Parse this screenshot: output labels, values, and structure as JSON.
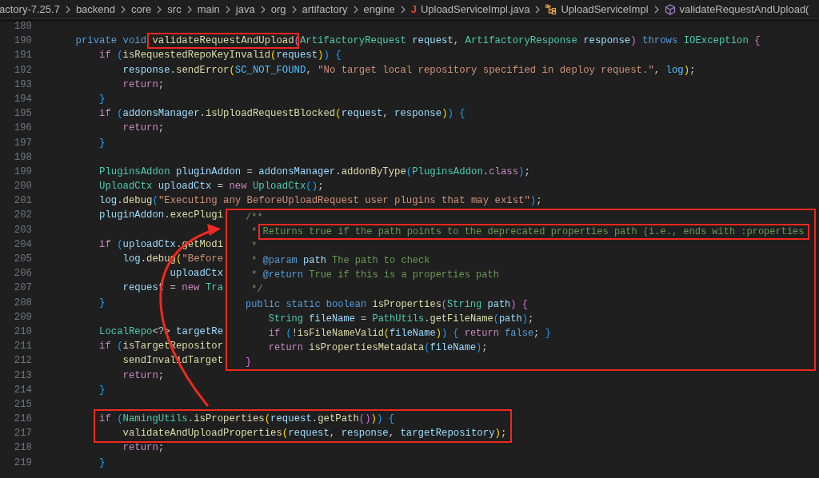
{
  "breadcrumb": [
    {
      "kind": "folder",
      "label": "actory-7.25.7"
    },
    {
      "kind": "folder",
      "label": "backend"
    },
    {
      "kind": "folder",
      "label": "core"
    },
    {
      "kind": "folder",
      "label": "src"
    },
    {
      "kind": "folder",
      "label": "main"
    },
    {
      "kind": "folder",
      "label": "java"
    },
    {
      "kind": "folder",
      "label": "org"
    },
    {
      "kind": "folder",
      "label": "artifactory"
    },
    {
      "kind": "folder",
      "label": "engine"
    },
    {
      "kind": "java-file",
      "icon": "J",
      "label": "UploadServiceImpl.java"
    },
    {
      "kind": "class",
      "label": "UploadServiceImpl"
    },
    {
      "kind": "method",
      "label": "validateRequestAndUpload("
    }
  ],
  "editor": {
    "lines": [
      {
        "number": "189"
      },
      {
        "number": "190",
        "tokens": [
          {
            "kind": "kw",
            "text": "    private void "
          },
          {
            "kind": "fn",
            "text": "validateRequestAndUpload",
            "boxed": true
          },
          {
            "kind": "b2",
            "text": "("
          },
          {
            "kind": "type",
            "text": "ArtifactoryRequest "
          },
          {
            "kind": "var",
            "text": "request"
          },
          {
            "kind": "p",
            "text": ", "
          },
          {
            "kind": "type",
            "text": "ArtifactoryResponse "
          },
          {
            "kind": "var",
            "text": "response"
          },
          {
            "kind": "b2",
            "text": ")"
          },
          {
            "kind": "kw",
            "text": " throws "
          },
          {
            "kind": "type",
            "text": "IOException "
          },
          {
            "kind": "b2",
            "text": "{"
          }
        ]
      },
      {
        "number": "191",
        "tokens": [
          {
            "kind": "ctl",
            "text": "        if "
          },
          {
            "kind": "b3",
            "text": "("
          },
          {
            "kind": "fn",
            "text": "isRequestedRepoKeyInvalid"
          },
          {
            "kind": "b1",
            "text": "("
          },
          {
            "kind": "var",
            "text": "request"
          },
          {
            "kind": "b1",
            "text": ")"
          },
          {
            "kind": "b3",
            "text": ")"
          },
          {
            "kind": "b3",
            "text": " {"
          }
        ]
      },
      {
        "number": "192",
        "tokens": [
          {
            "kind": "var",
            "text": "            response"
          },
          {
            "kind": "p",
            "text": "."
          },
          {
            "kind": "fn",
            "text": "sendError"
          },
          {
            "kind": "b1",
            "text": "("
          },
          {
            "kind": "const",
            "text": "SC_NOT_FOUND"
          },
          {
            "kind": "p",
            "text": ", "
          },
          {
            "kind": "str",
            "text": "\"No target local repository specified in deploy request.\""
          },
          {
            "kind": "p",
            "text": ", "
          },
          {
            "kind": "const",
            "text": "log"
          },
          {
            "kind": "b1",
            "text": ")"
          },
          {
            "kind": "p",
            "text": ";"
          }
        ]
      },
      {
        "number": "193",
        "tokens": [
          {
            "kind": "ctl",
            "text": "            return"
          },
          {
            "kind": "p",
            "text": ";"
          }
        ]
      },
      {
        "number": "194",
        "tokens": [
          {
            "kind": "b3",
            "text": "        }"
          }
        ]
      },
      {
        "number": "195",
        "tokens": [
          {
            "kind": "ctl",
            "text": "        if "
          },
          {
            "kind": "b3",
            "text": "("
          },
          {
            "kind": "var",
            "text": "addonsManager"
          },
          {
            "kind": "p",
            "text": "."
          },
          {
            "kind": "fn",
            "text": "isUploadRequestBlocked"
          },
          {
            "kind": "b1",
            "text": "("
          },
          {
            "kind": "var",
            "text": "request"
          },
          {
            "kind": "p",
            "text": ", "
          },
          {
            "kind": "var",
            "text": "response"
          },
          {
            "kind": "b1",
            "text": ")"
          },
          {
            "kind": "b3",
            "text": ")"
          },
          {
            "kind": "b3",
            "text": " {"
          }
        ]
      },
      {
        "number": "196",
        "tokens": [
          {
            "kind": "ctl",
            "text": "            return"
          },
          {
            "kind": "p",
            "text": ";"
          }
        ]
      },
      {
        "number": "197",
        "tokens": [
          {
            "kind": "b3",
            "text": "        }"
          }
        ]
      },
      {
        "number": "198"
      },
      {
        "number": "199",
        "tokens": [
          {
            "kind": "type",
            "text": "        PluginsAddon "
          },
          {
            "kind": "var",
            "text": "pluginAddon"
          },
          {
            "kind": "p",
            "text": " = "
          },
          {
            "kind": "var",
            "text": "addonsManager"
          },
          {
            "kind": "p",
            "text": "."
          },
          {
            "kind": "fn",
            "text": "addonByType"
          },
          {
            "kind": "b3",
            "text": "("
          },
          {
            "kind": "type",
            "text": "PluginsAddon"
          },
          {
            "kind": "p",
            "text": "."
          },
          {
            "kind": "ctl",
            "text": "class"
          },
          {
            "kind": "b3",
            "text": ")"
          },
          {
            "kind": "p",
            "text": ";"
          }
        ]
      },
      {
        "number": "200",
        "tokens": [
          {
            "kind": "type",
            "text": "        UploadCtx "
          },
          {
            "kind": "var",
            "text": "uploadCtx"
          },
          {
            "kind": "p",
            "text": " = "
          },
          {
            "kind": "ctl",
            "text": "new "
          },
          {
            "kind": "type",
            "text": "UploadCtx"
          },
          {
            "kind": "b3",
            "text": "()"
          },
          {
            "kind": "p",
            "text": ";"
          }
        ]
      },
      {
        "number": "201",
        "tokens": [
          {
            "kind": "var",
            "text": "        log"
          },
          {
            "kind": "p",
            "text": "."
          },
          {
            "kind": "fn",
            "text": "debug"
          },
          {
            "kind": "b3",
            "text": "("
          },
          {
            "kind": "str",
            "text": "\"Executing any BeforeUploadRequest user plugins that may exist\""
          },
          {
            "kind": "b3",
            "text": ")"
          },
          {
            "kind": "p",
            "text": ";"
          }
        ]
      },
      {
        "number": "202",
        "tokens": [
          {
            "kind": "var",
            "text": "        pluginAddon"
          },
          {
            "kind": "p",
            "text": "."
          },
          {
            "kind": "fn",
            "text": "execPlugi"
          }
        ]
      },
      {
        "number": "203"
      },
      {
        "number": "204",
        "tokens": [
          {
            "kind": "ctl",
            "text": "        if "
          },
          {
            "kind": "b3",
            "text": "("
          },
          {
            "kind": "var",
            "text": "uploadCtx"
          },
          {
            "kind": "p",
            "text": "."
          },
          {
            "kind": "fn",
            "text": "getModi"
          }
        ]
      },
      {
        "number": "205",
        "tokens": [
          {
            "kind": "var",
            "text": "            log"
          },
          {
            "kind": "p",
            "text": "."
          },
          {
            "kind": "fn",
            "text": "debug"
          },
          {
            "kind": "b1",
            "text": "("
          },
          {
            "kind": "str",
            "text": "\"Before"
          }
        ]
      },
      {
        "number": "206",
        "tokens": [
          {
            "kind": "var",
            "text": "                    uploadCtx"
          }
        ]
      },
      {
        "number": "207",
        "tokens": [
          {
            "kind": "var",
            "text": "            request"
          },
          {
            "kind": "p",
            "text": " = "
          },
          {
            "kind": "ctl",
            "text": "new "
          },
          {
            "kind": "type",
            "text": "Tra"
          }
        ]
      },
      {
        "number": "208",
        "tokens": [
          {
            "kind": "b3",
            "text": "        }"
          }
        ]
      },
      {
        "number": "209"
      },
      {
        "number": "210",
        "tokens": [
          {
            "kind": "type",
            "text": "        LocalRepo"
          },
          {
            "kind": "p",
            "text": "<?> "
          },
          {
            "kind": "var",
            "text": "targetRe"
          }
        ]
      },
      {
        "number": "211",
        "tokens": [
          {
            "kind": "ctl",
            "text": "        if "
          },
          {
            "kind": "b3",
            "text": "("
          },
          {
            "kind": "fn",
            "text": "isTargetRepositor"
          }
        ]
      },
      {
        "number": "212",
        "tokens": [
          {
            "kind": "fn",
            "text": "            sendInvalidTarget"
          }
        ]
      },
      {
        "number": "213",
        "tokens": [
          {
            "kind": "ctl",
            "text": "            return"
          },
          {
            "kind": "p",
            "text": ";"
          }
        ]
      },
      {
        "number": "214",
        "tokens": [
          {
            "kind": "b3",
            "text": "        }"
          }
        ]
      },
      {
        "number": "215"
      },
      {
        "number": "216",
        "boxed": true,
        "tokens": [
          {
            "kind": "ctl",
            "text": "        if "
          },
          {
            "kind": "b3",
            "text": "("
          },
          {
            "kind": "type",
            "text": "NamingUtils"
          },
          {
            "kind": "p",
            "text": "."
          },
          {
            "kind": "fn",
            "text": "isProperties"
          },
          {
            "kind": "b1",
            "text": "("
          },
          {
            "kind": "var",
            "text": "request"
          },
          {
            "kind": "p",
            "text": "."
          },
          {
            "kind": "fn",
            "text": "getPath"
          },
          {
            "kind": "b2",
            "text": "()"
          },
          {
            "kind": "b1",
            "text": ")"
          },
          {
            "kind": "b3",
            "text": ")"
          },
          {
            "kind": "b3",
            "text": " {"
          }
        ]
      },
      {
        "number": "217",
        "boxed": true,
        "tokens": [
          {
            "kind": "fn",
            "text": "            validateAndUploadProperties"
          },
          {
            "kind": "b1",
            "text": "("
          },
          {
            "kind": "var",
            "text": "request"
          },
          {
            "kind": "p",
            "text": ", "
          },
          {
            "kind": "var",
            "text": "response"
          },
          {
            "kind": "p",
            "text": ", "
          },
          {
            "kind": "var",
            "text": "targetRepository"
          },
          {
            "kind": "b1",
            "text": ")"
          },
          {
            "kind": "p",
            "text": ";"
          }
        ]
      },
      {
        "number": "218",
        "tokens": [
          {
            "kind": "ctl",
            "text": "            return"
          },
          {
            "kind": "p",
            "text": ";"
          }
        ]
      },
      {
        "number": "219",
        "tokens": [
          {
            "kind": "b3",
            "text": "        }"
          }
        ]
      }
    ]
  },
  "popup": {
    "lines": [
      {
        "tokens": [
          {
            "kind": "cm",
            "text": "/**"
          }
        ]
      },
      {
        "tokens": [
          {
            "kind": "cm",
            "text": " * "
          },
          {
            "kind": "cm",
            "text": "Returns true if the path points to the deprecated properties path (i.e., ends with :properties",
            "boxed": true
          }
        ]
      },
      {
        "tokens": [
          {
            "kind": "cm",
            "text": " *"
          }
        ]
      },
      {
        "tokens": [
          {
            "kind": "cm",
            "text": " * "
          },
          {
            "kind": "tag",
            "text": "@param"
          },
          {
            "kind": "var",
            "text": " path"
          },
          {
            "kind": "cm",
            "text": " The path to check"
          }
        ]
      },
      {
        "tokens": [
          {
            "kind": "cm",
            "text": " * "
          },
          {
            "kind": "tag",
            "text": "@return"
          },
          {
            "kind": "cm",
            "text": " True if this is a properties path"
          }
        ]
      },
      {
        "tokens": [
          {
            "kind": "cm",
            "text": " */"
          }
        ]
      },
      {
        "tokens": [
          {
            "kind": "kw",
            "text": "public static boolean "
          },
          {
            "kind": "fn",
            "text": "isProperties"
          },
          {
            "kind": "b2",
            "text": "("
          },
          {
            "kind": "type",
            "text": "String "
          },
          {
            "kind": "var",
            "text": "path"
          },
          {
            "kind": "b2",
            "text": ")"
          },
          {
            "kind": "b2",
            "text": " {"
          }
        ]
      },
      {
        "tokens": [
          {
            "kind": "type",
            "text": "    String "
          },
          {
            "kind": "var",
            "text": "fileName"
          },
          {
            "kind": "p",
            "text": " = "
          },
          {
            "kind": "type",
            "text": "PathUtils"
          },
          {
            "kind": "p",
            "text": "."
          },
          {
            "kind": "fn",
            "text": "getFileName"
          },
          {
            "kind": "b3",
            "text": "("
          },
          {
            "kind": "var",
            "text": "path"
          },
          {
            "kind": "b3",
            "text": ")"
          },
          {
            "kind": "p",
            "text": ";"
          }
        ]
      },
      {
        "tokens": [
          {
            "kind": "ctl",
            "text": "    if "
          },
          {
            "kind": "b3",
            "text": "("
          },
          {
            "kind": "p",
            "text": "!"
          },
          {
            "kind": "fn",
            "text": "isFileNameValid"
          },
          {
            "kind": "b1",
            "text": "("
          },
          {
            "kind": "var",
            "text": "fileName"
          },
          {
            "kind": "b1",
            "text": ")"
          },
          {
            "kind": "b3",
            "text": ")"
          },
          {
            "kind": "b3",
            "text": " {"
          },
          {
            "kind": "ctl",
            "text": " return "
          },
          {
            "kind": "kw",
            "text": "false"
          },
          {
            "kind": "p",
            "text": "; "
          },
          {
            "kind": "b3",
            "text": "}"
          }
        ]
      },
      {
        "tokens": [
          {
            "kind": "ctl",
            "text": "    return "
          },
          {
            "kind": "fn",
            "text": "isPropertiesMetadata"
          },
          {
            "kind": "b3",
            "text": "("
          },
          {
            "kind": "var",
            "text": "fileName"
          },
          {
            "kind": "b3",
            "text": ")"
          },
          {
            "kind": "p",
            "text": ";"
          }
        ]
      },
      {
        "tokens": [
          {
            "kind": "b2",
            "text": "}"
          }
        ]
      }
    ]
  }
}
